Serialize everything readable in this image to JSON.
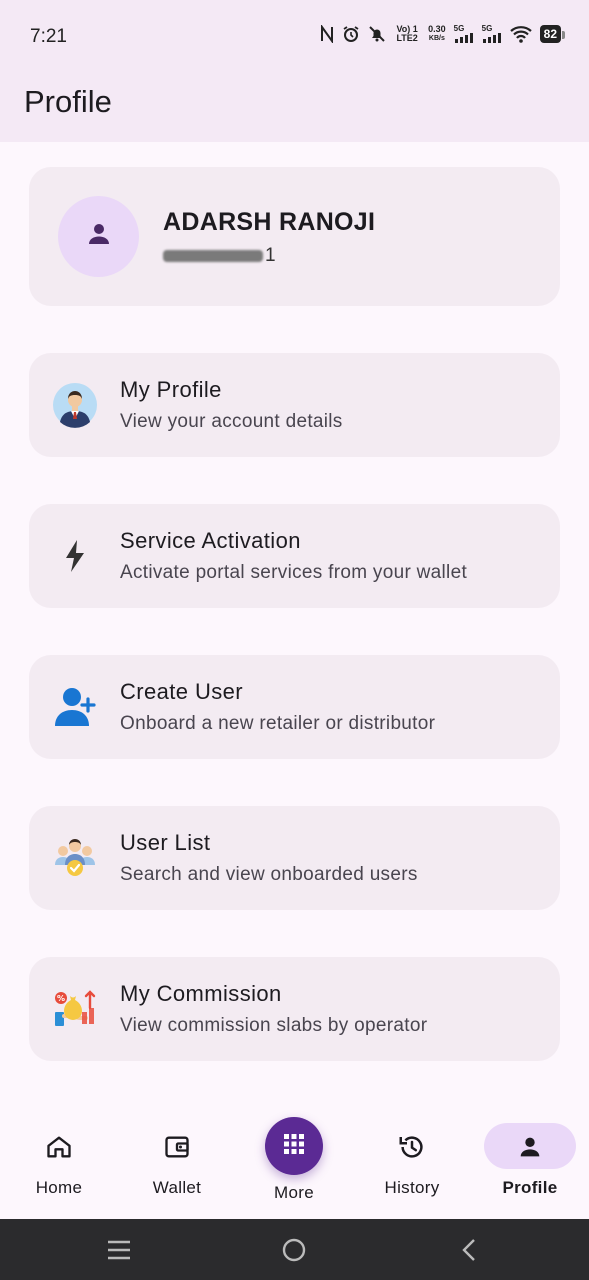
{
  "status_bar": {
    "time": "7:21",
    "icons": [
      "nfc-icon",
      "alarm-icon",
      "mute-icon",
      "volte-icon",
      "data-speed-icon",
      "signal-5g-icon",
      "signal-5g-icon",
      "wifi-icon",
      "battery-icon"
    ],
    "volte_text": "Vo) 1 LTE2",
    "speed_value": "0.30",
    "speed_unit": "KB/s",
    "sim1_label": "5G",
    "sim2_label": "5G",
    "battery_level": "82"
  },
  "app_bar": {
    "title": "Profile"
  },
  "user": {
    "name": "ADARSH RANOJI",
    "phone_suffix": "1",
    "avatar_icon": "person-icon"
  },
  "menu": [
    {
      "title": "My Profile",
      "subtitle": "View your account details",
      "icon": "businessman-avatar-icon"
    },
    {
      "title": "Service Activation",
      "subtitle": "Activate portal services from your wallet",
      "icon": "lightning-bolt-icon"
    },
    {
      "title": "Create User",
      "subtitle": "Onboard a new retailer or distributor",
      "icon": "add-user-icon"
    },
    {
      "title": "User List",
      "subtitle": "Search and view onboarded users",
      "icon": "user-group-icon"
    },
    {
      "title": "My Commission",
      "subtitle": "View commission slabs by operator",
      "icon": "commission-icon"
    }
  ],
  "bottom_nav": {
    "items": [
      {
        "label": "Home",
        "icon": "home-icon"
      },
      {
        "label": "Wallet",
        "icon": "wallet-icon"
      },
      {
        "label": "More",
        "icon": "grid-icon"
      },
      {
        "label": "History",
        "icon": "history-icon"
      },
      {
        "label": "Profile",
        "icon": "person-icon"
      }
    ],
    "active": "Profile"
  },
  "colors": {
    "accent": "#5b2a94",
    "active_pill": "#ead8f8",
    "card_bg": "#f3ebf2",
    "header_bg": "#f4e9f5"
  }
}
